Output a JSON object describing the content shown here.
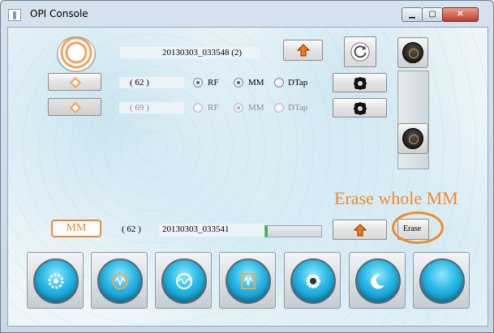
{
  "window": {
    "title": "OPI Console",
    "minimize_label": "▁",
    "maximize_label": "▢",
    "close_label": "✕"
  },
  "top_row": {
    "filename": "20130303_033548 (2)"
  },
  "row1": {
    "count": "( 62 )",
    "rf": "RF",
    "mm": "MM",
    "dtap": "DTap",
    "rf_selected": true,
    "mm_selected": true,
    "dtap_selected": false
  },
  "row2": {
    "count": "( 69 )",
    "rf": "RF",
    "mm": "MM",
    "dtap": "DTap",
    "rf_selected": false,
    "mm_selected": true,
    "dtap_selected": false
  },
  "mm_row": {
    "badge": "MM",
    "count": "( 62 )",
    "filename": "20130303_033541",
    "progress": 0.05,
    "erase_label": "Erase"
  },
  "annotation": "Erase whole MM",
  "colors": {
    "accent_orange": "#ef8a2c",
    "orb_blue": "#26b6e4",
    "progress_green": "#39b54a"
  },
  "bottom_buttons": [
    {
      "icon": "gear-icon"
    },
    {
      "icon": "rotate-wave-icon"
    },
    {
      "icon": "circle-wave-icon"
    },
    {
      "icon": "frame-wave-icon"
    },
    {
      "icon": "sun-eye-icon"
    },
    {
      "icon": "moon-icon"
    },
    {
      "icon": "blank-orb-icon"
    }
  ]
}
